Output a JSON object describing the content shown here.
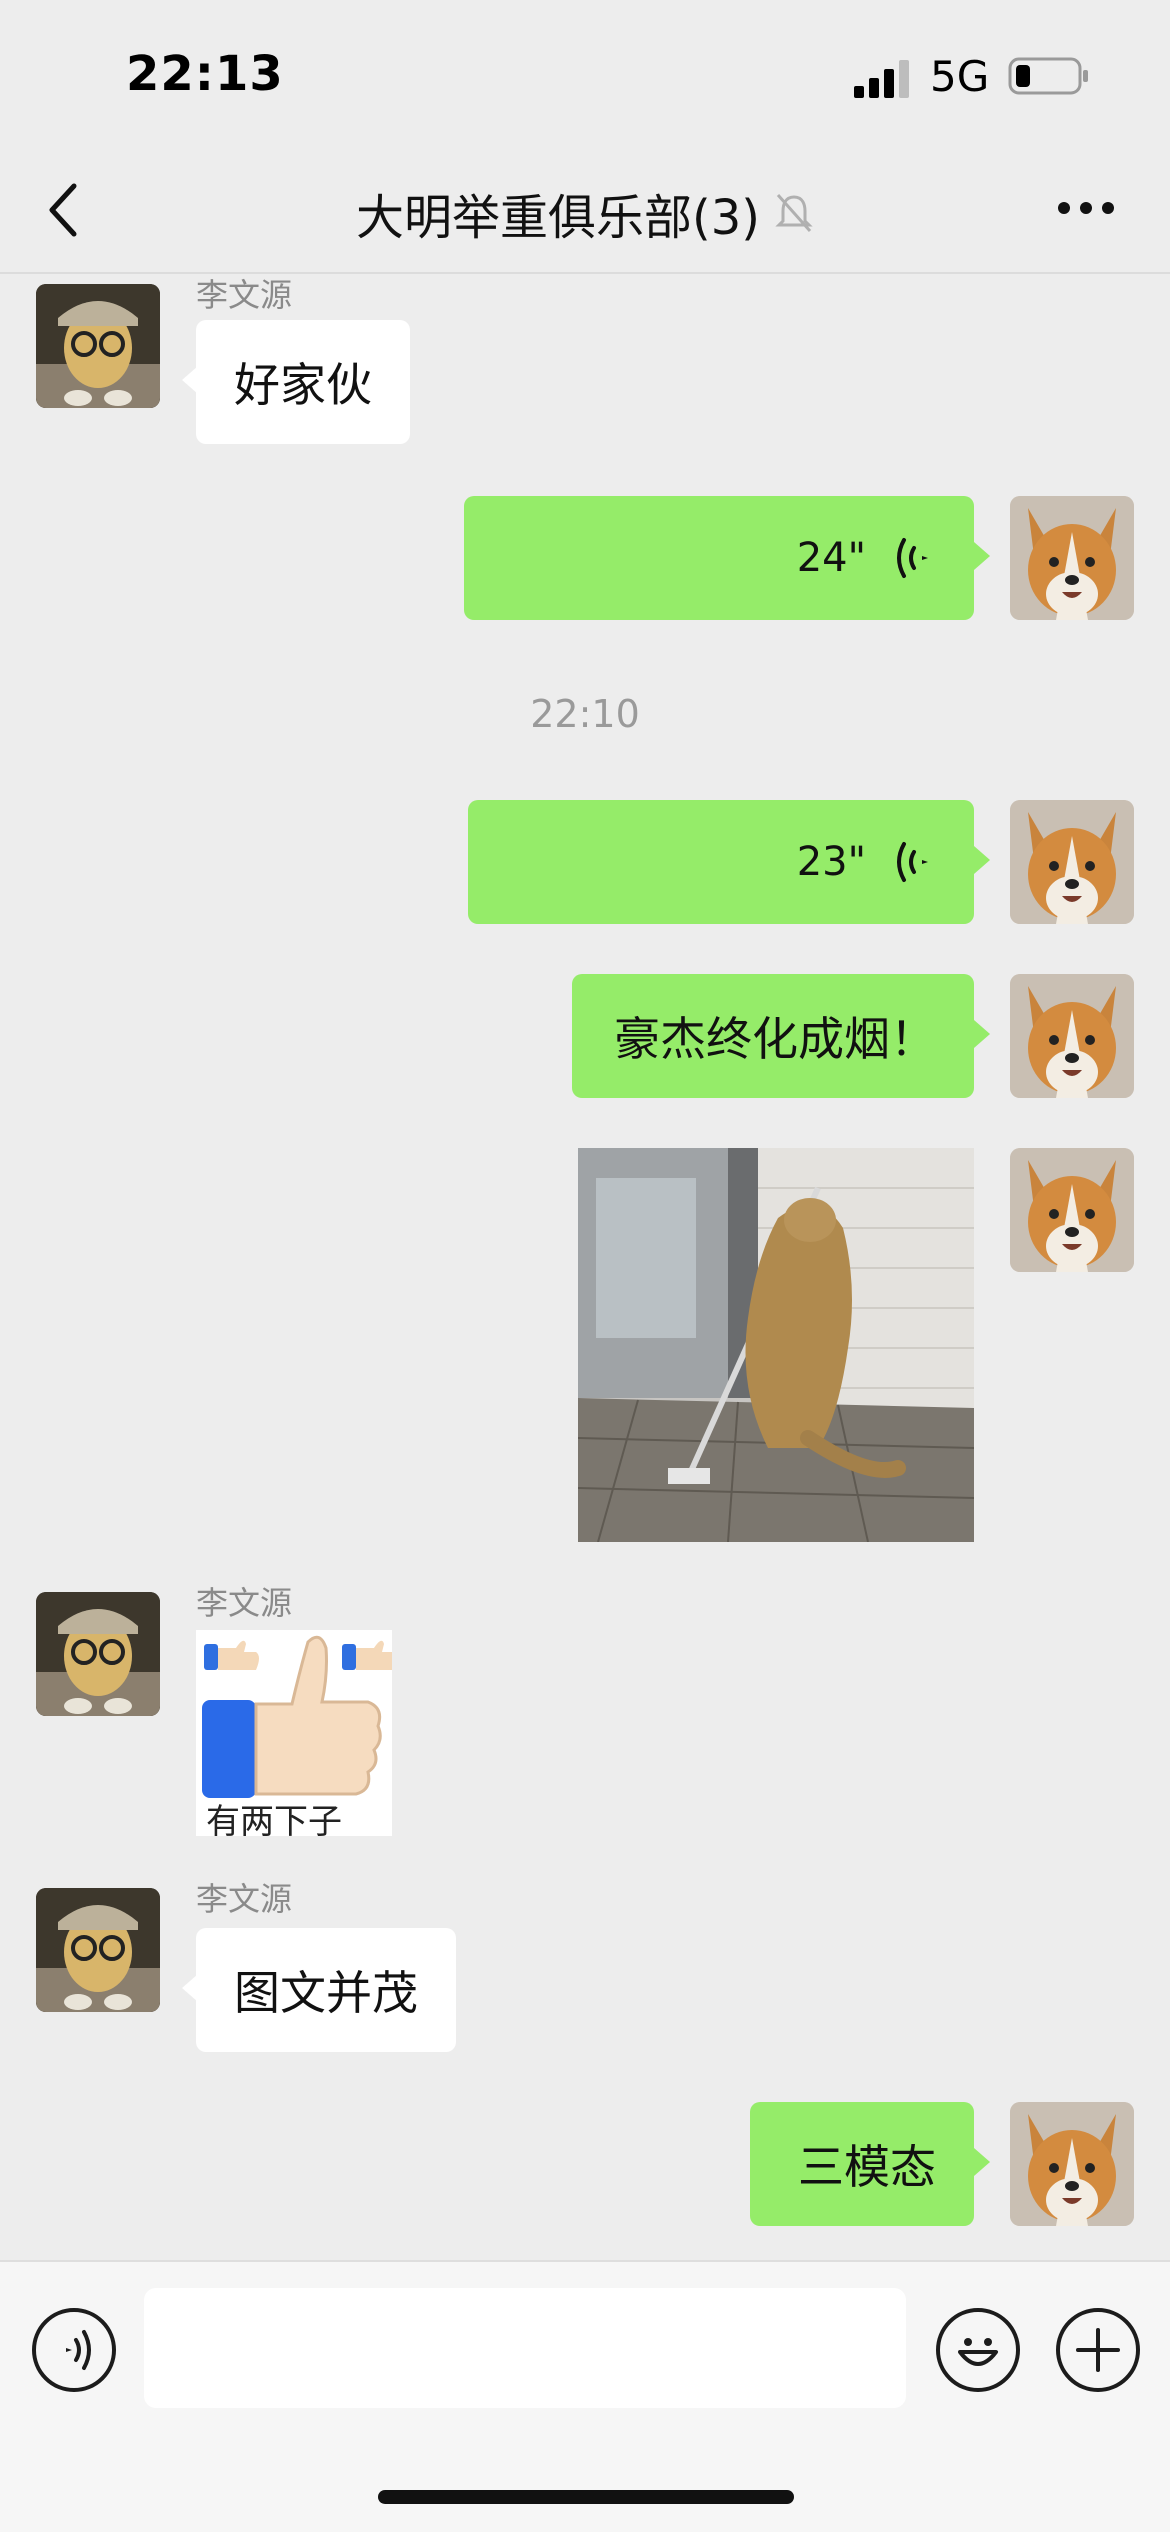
{
  "status_bar": {
    "time": "22:13",
    "network": "5G",
    "battery_level_percent": 20
  },
  "header": {
    "title": "大明举重俱乐部(3)",
    "back_icon": "chevron-left-icon",
    "mute_icon": "bell-slash-icon",
    "more_icon": "more-dots-icon"
  },
  "messages": [
    {
      "type": "text",
      "side": "left",
      "sender": "李文源",
      "text": "好家伙"
    },
    {
      "type": "voice",
      "side": "right",
      "duration": "24\""
    },
    {
      "type": "timestamp",
      "text": "22:10"
    },
    {
      "type": "voice",
      "side": "right",
      "duration": "23\""
    },
    {
      "type": "text",
      "side": "right",
      "text": "豪杰终化成烟！"
    },
    {
      "type": "image",
      "side": "right",
      "content": "cat-with-mop-gif"
    },
    {
      "type": "sticker",
      "side": "left",
      "sender": "李文源",
      "caption": "有两下子"
    },
    {
      "type": "text",
      "side": "left",
      "sender": "李文源",
      "text": "图文并茂"
    },
    {
      "type": "text",
      "side": "right",
      "text": "三模态"
    }
  ],
  "input_bar": {
    "voice_icon": "voice-input-icon",
    "emoji_icon": "emoji-icon",
    "plus_icon": "plus-icon",
    "value": ""
  },
  "colors": {
    "background": "#ededed",
    "self_bubble": "#95ec69",
    "other_bubble": "#ffffff",
    "sender_name": "#8a8a8a"
  }
}
